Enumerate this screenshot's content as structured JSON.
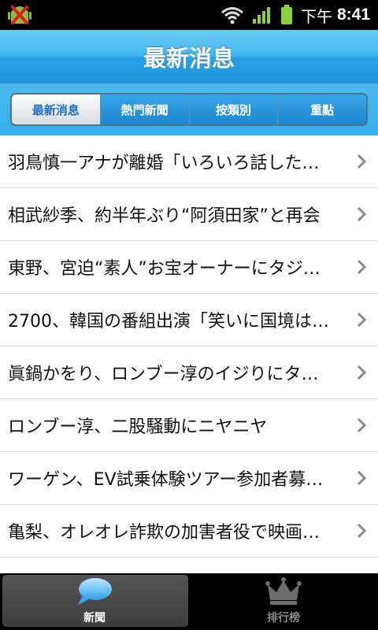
{
  "status_bar": {
    "time_prefix": "下午",
    "time": "8:41"
  },
  "header": {
    "title": "最新消息"
  },
  "segments": [
    {
      "label": "最新消息",
      "active": true
    },
    {
      "label": "熱門新聞",
      "active": false
    },
    {
      "label": "按類別",
      "active": false
    },
    {
      "label": "重點",
      "active": false
    }
  ],
  "news": [
    "羽鳥慎一アナが離婚「いろいろ話した…",
    "相武紗季、約半年ぶり“阿須田家”と再会",
    "東野、宮迫“素人”お宝オーナーにタジ…",
    "2700、韓国の番組出演「笑いに国境は…",
    "眞鍋かをり、ロンブー淳のイジりにタ…",
    "ロンブー淳、二股騒動にニヤニヤ",
    "ワーゲン、EV試乗体験ツアー参加者募…",
    "亀梨、オレオレ詐欺の加害者役で映画…"
  ],
  "tabbar": {
    "news_label": "新聞",
    "rank_label": "排行榜"
  },
  "colors": {
    "header_blue": "#2aa2e4",
    "active_tab_text": "#1f6fc3"
  },
  "icons": {
    "app": "android-debug-icon",
    "wifi": "wifi-icon",
    "signal": "signal-icon",
    "battery": "battery-icon",
    "chevron": "chevron-right-icon",
    "news_tab": "speech-bubble-icon",
    "rank_tab": "crown-icon"
  }
}
